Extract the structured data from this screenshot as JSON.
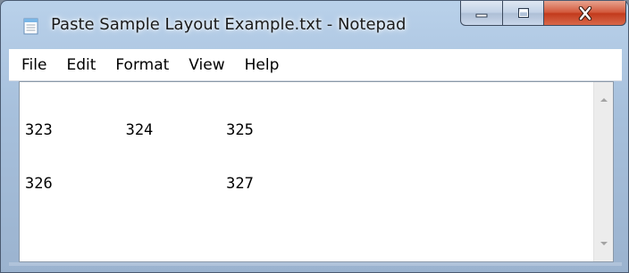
{
  "window": {
    "title": "Paste Sample Layout Example.txt - Notepad",
    "app_icon": "notepad-icon",
    "caption_icons": {
      "minimize": "minimize-icon",
      "maximize": "maximize-icon",
      "close": "close-icon"
    },
    "close_color": "#c7401f"
  },
  "menu": {
    "items": [
      {
        "label": "File"
      },
      {
        "label": "Edit"
      },
      {
        "label": "Format"
      },
      {
        "label": "View"
      },
      {
        "label": "Help"
      }
    ]
  },
  "editor": {
    "lines": [
      "323        324        325",
      "326                   327"
    ]
  },
  "scrollbar": {
    "up_icon": "scroll-up-arrow-icon",
    "down_icon": "scroll-down-arrow-icon"
  }
}
